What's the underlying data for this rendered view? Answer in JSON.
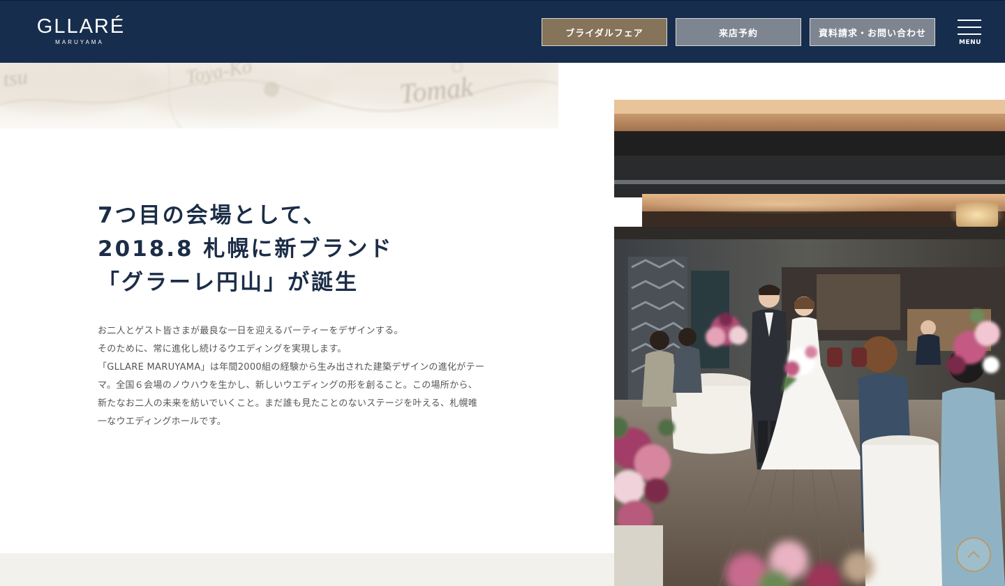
{
  "header": {
    "logo_main": "GLLARÉ",
    "logo_sub": "MARUYAMA",
    "buttons": {
      "fair": "ブライダルフェア",
      "visit": "来店予約",
      "docs": "資料請求・お問い合わせ"
    },
    "menu_label": "MENU"
  },
  "map": {
    "labels": [
      "tsu",
      "Toya-Ko",
      "Tomak"
    ]
  },
  "main": {
    "headline": [
      "7つ目の会場として、",
      "2018.8 札幌に新ブランド",
      "「グラーレ円山」が誕生"
    ],
    "body": [
      "お二人とゲスト皆さまが最良な一日を迎えるパーティーをデザインする。",
      "そのために、常に進化し続けるウエディングを実現します。",
      "「GLLARE MARUYAMA」は年間2000組の経験から生み出された建築デザインの進化がテー",
      "マ。全国６会場のノウハウを生かし、新しいウエディングの形を創ること。この場所から、",
      "新たなお二人の未来を紡いでいくこと。まだ誰も見たことのないステージを叶える、札幌唯",
      "一なウエディングホールです。"
    ]
  },
  "colors": {
    "header_bg": "#172d4d",
    "fair_button": "#85735a",
    "gray_button": "#7d8590",
    "headline": "#1b2d47",
    "accent_gold": "#b99a6b"
  },
  "icons": {
    "menu": "hamburger-menu-icon",
    "scroll_top": "chevron-up-icon"
  }
}
